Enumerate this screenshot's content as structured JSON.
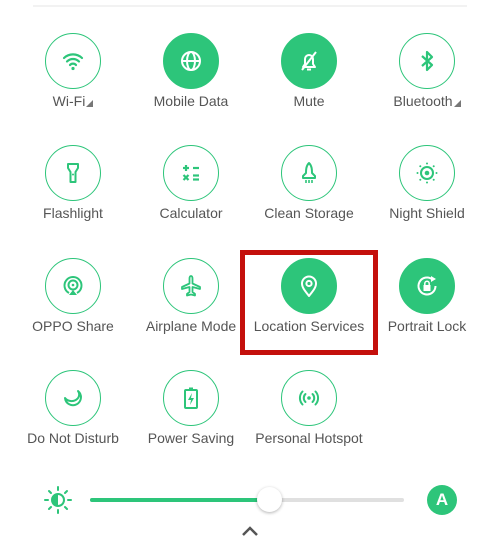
{
  "accent_color": "#2dc57a",
  "highlight_color": "#c4100c",
  "tiles": [
    {
      "label": "Wi-Fi",
      "icon": "wifi-icon",
      "active": false,
      "expandable": true
    },
    {
      "label": "Mobile Data",
      "icon": "globe-icon",
      "active": true,
      "expandable": false
    },
    {
      "label": "Mute",
      "icon": "bell-off-icon",
      "active": true,
      "expandable": false
    },
    {
      "label": "Bluetooth",
      "icon": "bluetooth-icon",
      "active": false,
      "expandable": true
    },
    {
      "label": "Flashlight",
      "icon": "flashlight-icon",
      "active": false,
      "expandable": false
    },
    {
      "label": "Calculator",
      "icon": "calculator-icon",
      "active": false,
      "expandable": false
    },
    {
      "label": "Clean Storage",
      "icon": "rocket-icon",
      "active": false,
      "expandable": false
    },
    {
      "label": "Night Shield",
      "icon": "eye-sun-icon",
      "active": false,
      "expandable": false
    },
    {
      "label": "OPPO Share",
      "icon": "share-radar-icon",
      "active": false,
      "expandable": false
    },
    {
      "label": "Airplane Mode",
      "icon": "airplane-icon",
      "active": false,
      "expandable": false
    },
    {
      "label": "Location Services",
      "icon": "location-pin-icon",
      "active": true,
      "expandable": false,
      "highlighted": true
    },
    {
      "label": "Portrait Lock",
      "icon": "rotation-lock-icon",
      "active": true,
      "expandable": false
    },
    {
      "label": "Do Not Disturb",
      "icon": "moon-icon",
      "active": false,
      "expandable": false
    },
    {
      "label": "Power Saving",
      "icon": "battery-bolt-icon",
      "active": false,
      "expandable": false
    },
    {
      "label": "Personal Hotspot",
      "icon": "hotspot-icon",
      "active": false,
      "expandable": false
    }
  ],
  "brightness": {
    "level_percent": 57,
    "auto_label": "A"
  }
}
